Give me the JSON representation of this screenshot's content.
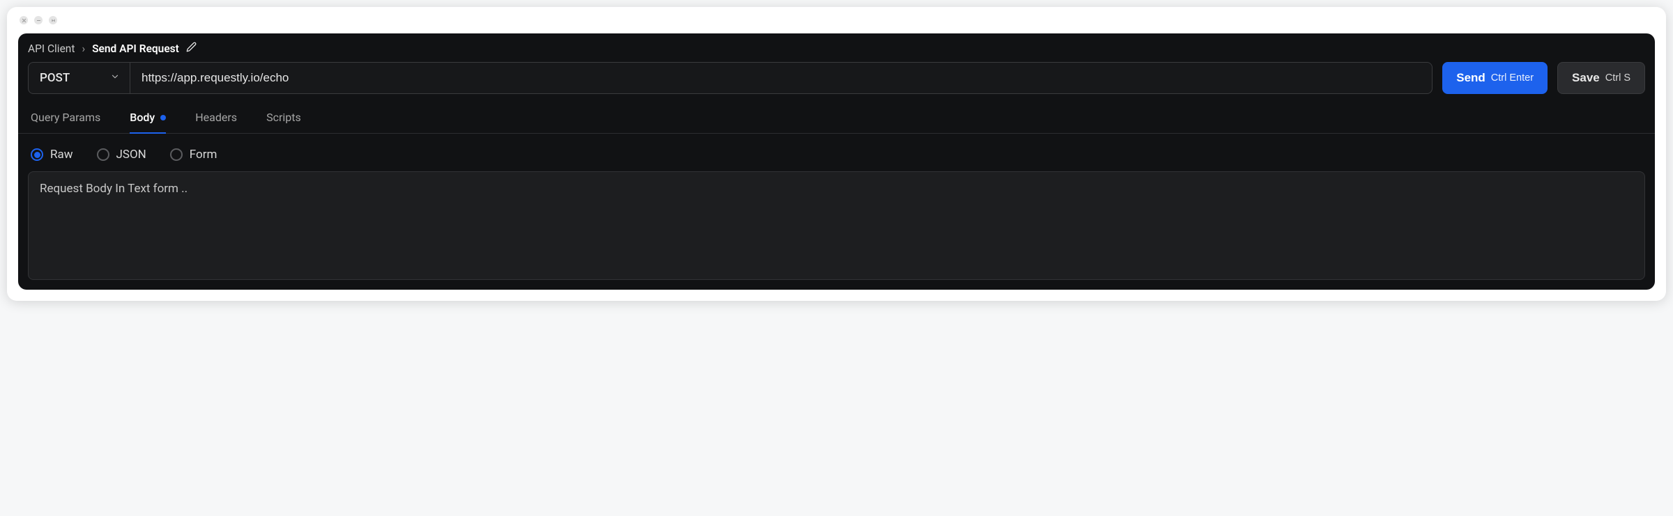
{
  "breadcrumb": {
    "root": "API Client",
    "current": "Send API Request"
  },
  "request": {
    "method": "POST",
    "url": "https://app.requestly.io/echo"
  },
  "actions": {
    "send_label": "Send",
    "send_shortcut": "Ctrl Enter",
    "save_label": "Save",
    "save_shortcut": "Ctrl S"
  },
  "tabs": {
    "query_params": "Query Params",
    "body": "Body",
    "headers": "Headers",
    "scripts": "Scripts",
    "active": "body",
    "body_has_indicator": true
  },
  "body_types": {
    "raw": "Raw",
    "json": "JSON",
    "form": "Form",
    "selected": "raw"
  },
  "body_editor": {
    "value": "Request Body In Text form .."
  }
}
